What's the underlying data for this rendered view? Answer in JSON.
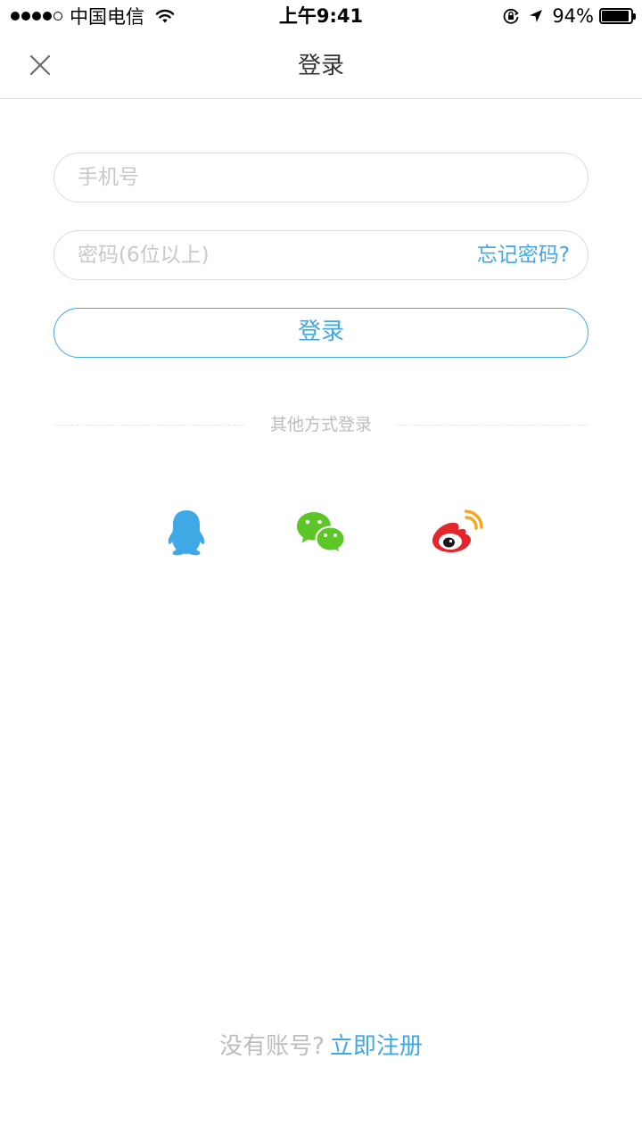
{
  "status_bar": {
    "signal_dots_filled": 4,
    "signal_dots_total": 5,
    "carrier": "中国电信",
    "time": "上午9:41",
    "battery_percent": "94%",
    "battery_level": 0.94
  },
  "nav": {
    "close_icon": "close-icon",
    "title": "登录"
  },
  "form": {
    "phone_placeholder": "手机号",
    "phone_value": "",
    "password_placeholder": "密码(6位以上)",
    "password_value": "",
    "forgot_label": "忘记密码?",
    "login_label": "登录"
  },
  "other_login": {
    "label": "其他方式登录",
    "providers": [
      {
        "name": "qq",
        "icon": "qq-icon",
        "color": "#3fa9e6"
      },
      {
        "name": "wechat",
        "icon": "wechat-icon",
        "color": "#5cc626"
      },
      {
        "name": "weibo",
        "icon": "weibo-icon",
        "color": "#e4262c"
      }
    ]
  },
  "footer": {
    "no_account": "没有账号?",
    "register_label": "立即注册"
  },
  "colors": {
    "accent": "#3fa9e6",
    "placeholder": "#c8c8c8",
    "border": "#dcdcdc",
    "muted_text": "#bdbdbd"
  }
}
